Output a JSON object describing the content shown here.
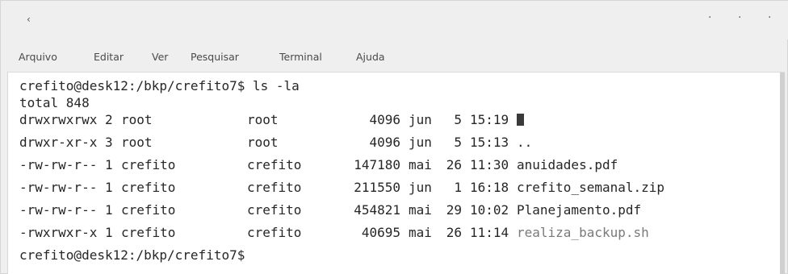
{
  "window": {
    "grip": "‹",
    "controls": [
      "·",
      "·",
      "·"
    ]
  },
  "menu": [
    "Arquivo",
    "Editar",
    "Ver",
    "Pesquisar",
    "Terminal",
    "Ajuda"
  ],
  "terminal": {
    "prompt_line": "crefito@desk12:/bkp/crefito7$ ls -la",
    "total_line": "total 848",
    "entries": [
      {
        "perms": "drwxrwxrwx",
        "links": "2",
        "owner": "root",
        "group": "root",
        "size": "4096",
        "month": "jun",
        "day": "5",
        "time": "15:19",
        "name": ""
      },
      {
        "perms": "drwxr-xr-x",
        "links": "3",
        "owner": "root",
        "group": "root",
        "size": "4096",
        "month": "jun",
        "day": "5",
        "time": "15:13",
        "name": ".."
      },
      {
        "perms": "-rw-rw-r--",
        "links": "1",
        "owner": "crefito",
        "group": "crefito",
        "size": "147180",
        "month": "mai",
        "day": "26",
        "time": "11:30",
        "name": "anuidades.pdf"
      },
      {
        "perms": "-rw-rw-r--",
        "links": "1",
        "owner": "crefito",
        "group": "crefito",
        "size": "211550",
        "month": "jun",
        "day": "1",
        "time": "16:18",
        "name": "crefito_semanal.zip"
      },
      {
        "perms": "-rw-rw-r--",
        "links": "1",
        "owner": "crefito",
        "group": "crefito",
        "size": "454821",
        "month": "mai",
        "day": "29",
        "time": "10:02",
        "name": "Planejamento.pdf"
      },
      {
        "perms": "-rwxrwxr-x",
        "links": "1",
        "owner": "crefito",
        "group": "crefito",
        "size": "40695",
        "month": "mai",
        "day": "26",
        "time": "11:14",
        "name": "realiza_backup.sh"
      }
    ],
    "final_prompt": "crefito@desk12:/bkp/crefito7$"
  }
}
